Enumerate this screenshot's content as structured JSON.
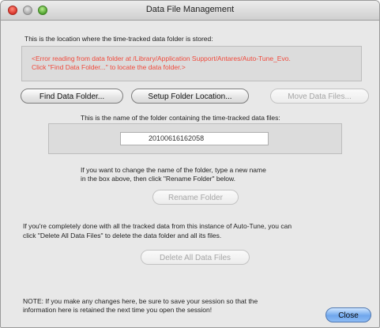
{
  "window": {
    "title": "Data File Management"
  },
  "location": {
    "intro": "This is the location where the time-tracked data folder is stored:",
    "error_line1": "<Error reading from data folder at /Library/Application Support/Antares/Auto-Tune_Evo.",
    "error_line2": "Click \"Find Data Folder...\" to locate the data folder.>"
  },
  "buttons": {
    "find": "Find Data Folder...",
    "setup": "Setup Folder Location...",
    "move": "Move Data Files...",
    "rename": "Rename Folder",
    "delete_all": "Delete All Data Files",
    "close": "Close"
  },
  "folder": {
    "label": "This is the name of the folder containing the time-tracked data files:",
    "name_value": "20100616162058",
    "hint_line1": "If you want to change the name of the folder, type a new name",
    "hint_line2": "in the box above, then click \"Rename Folder\" below."
  },
  "delete_info": {
    "line1": "If you're completely done with all the tracked data from this instance of Auto-Tune, you can",
    "line2": "click \"Delete All Data Files\" to delete the data folder and all its files."
  },
  "note": {
    "line1": "NOTE: If you make any changes here, be sure to save your session so that the",
    "line2": "information here is retained the next time you open the session!"
  },
  "colors": {
    "error_text": "#f04a3c",
    "default_button": "#6fa6ec",
    "close_light": "#d9342b",
    "minimize_light": "#a9a9a9",
    "zoom_light": "#4fa32e"
  }
}
